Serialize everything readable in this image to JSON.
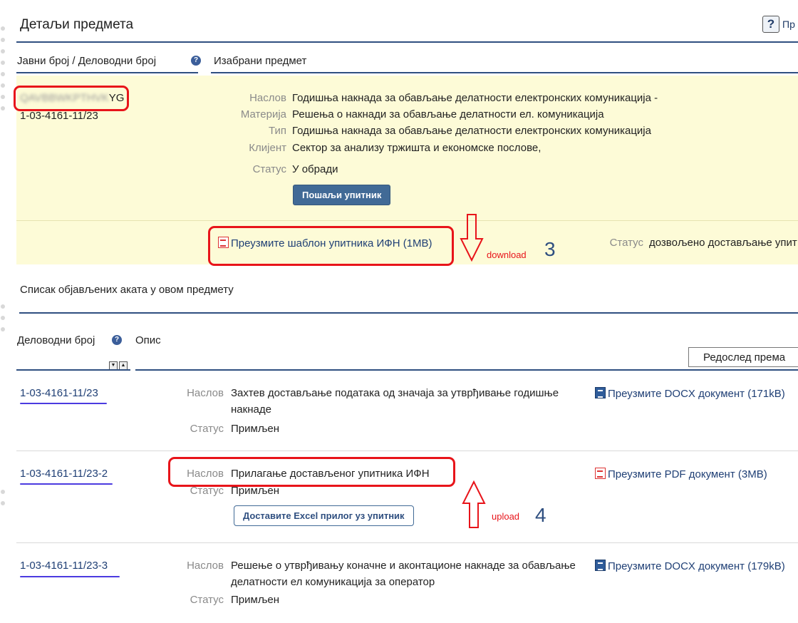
{
  "header": {
    "title": "Детаљи предмета",
    "help_icon": "?",
    "help_text": "Пр"
  },
  "columns": {
    "left": "Јавни број / Деловодни број",
    "right": "Изабрани предмет"
  },
  "case": {
    "public_number_blurred": "QAVBBWKPTHVK",
    "public_number_visible_suffix": "YG",
    "registry_number": "1-03-4161-11/23",
    "fields": [
      {
        "label": "Наслов",
        "value": "Годишња накнада за обављање делатности електронских комуникација -"
      },
      {
        "label": "Материја",
        "value": "Решења о накнади за обављање делатности ел. комуникација"
      },
      {
        "label": "Тип",
        "value": "Годишња накнада за обављање делатности електронских комуникација"
      },
      {
        "label": "Клијент",
        "value": "Сектор за анализу тржишта и економске послове,"
      },
      {
        "label": "Статус",
        "value": "У обради"
      }
    ],
    "send_button": "Пошаљи упитник",
    "template_link": "Преузмите шаблон упитника ИФН (1MB)",
    "status_label": "Статус",
    "status_value": "дозвољено достављање упит"
  },
  "annotations": {
    "download_text": "download",
    "download_num": "3",
    "upload_text": "upload",
    "upload_num": "4"
  },
  "acts": {
    "section_title": "Списак објављених аката у овом предмету",
    "col_registry": "Деловодни број",
    "col_desc": "Опис",
    "sort_label": "Редослед према",
    "rows": [
      {
        "number": "1-03-4161-11/23",
        "title_label": "Наслов",
        "title": "Захтев достављање података од значаја за утврђивање годишње",
        "title2": "накнаде",
        "status_label": "Статус",
        "status": "Примљен",
        "download": "Преузмите DOCX документ (171kB)",
        "download_type": "docx"
      },
      {
        "number": "1-03-4161-11/23-2",
        "title_label": "Наслов",
        "title": "Прилагање достављеног упитника ИФН",
        "title2": "",
        "status_label": "Статус",
        "status": "Примљен",
        "upload_button": "Доставите Excel прилог уз упитник",
        "download": "Преузмите PDF документ (3MB)",
        "download_type": "pdf"
      },
      {
        "number": "1-03-4161-11/23-3",
        "title_label": "Наслов",
        "title": "Решење о утврђивању коначне и аконтационе накнаде за обављање",
        "title2": "делатности ел комуникација за оператор",
        "status_label": "Статус",
        "status": "Примљен",
        "download": "Преузмите DOCX документ (179kB)",
        "download_type": "docx"
      }
    ]
  },
  "colors": {
    "accent": "#2f4f80",
    "panel_bg": "#fdfbd7",
    "highlight_red": "#e8141a",
    "underline_blue": "#4b3be0"
  }
}
